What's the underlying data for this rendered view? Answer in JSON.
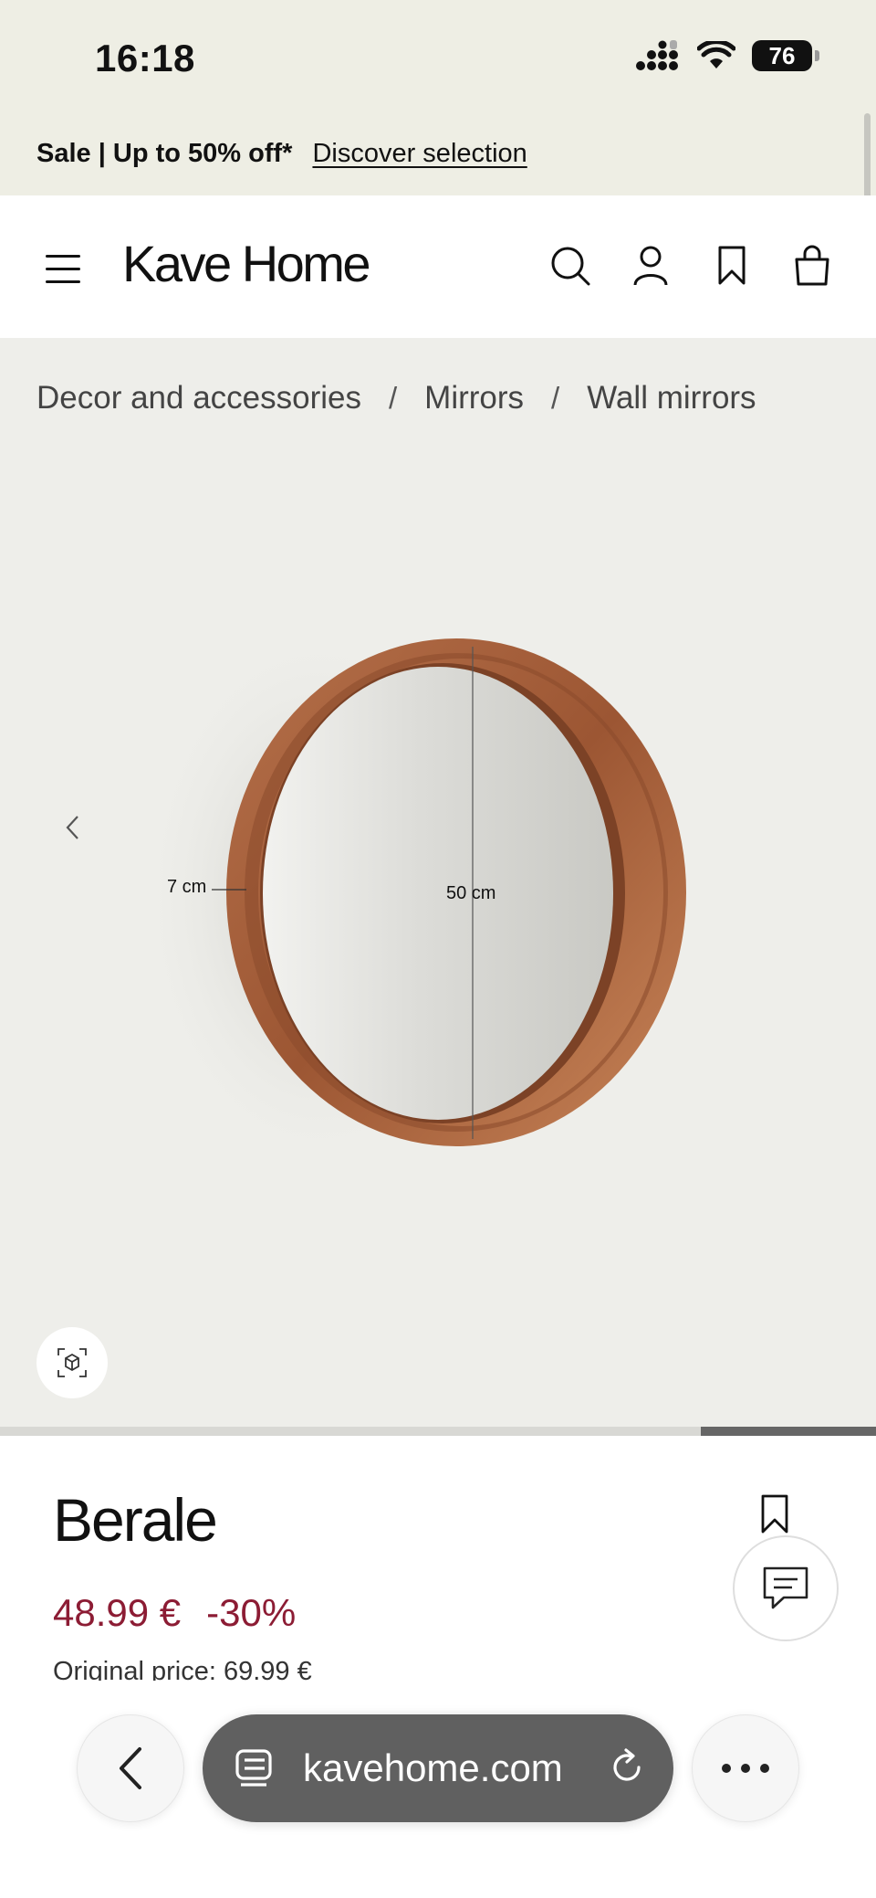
{
  "status_bar": {
    "time": "16:18",
    "battery": "76"
  },
  "promo": {
    "text": "Sale | Up to 50% off*",
    "link": "Discover selection"
  },
  "header": {
    "logo": "Kave Home"
  },
  "breadcrumb": [
    "Decor and accessories",
    "Mirrors",
    "Wall mirrors"
  ],
  "gallery": {
    "depth_label": "7 cm",
    "diameter_label": "50 cm",
    "progress": 0.2
  },
  "product": {
    "name": "Berale",
    "price": "48.99 €",
    "discount": "-30%",
    "original_price": "Original price: 69.99 €"
  },
  "browser": {
    "url": "kavehome.com"
  },
  "icons": {
    "menu": "hamburger-icon",
    "search": "search-icon",
    "account": "user-icon",
    "wishlist": "bookmark-icon",
    "cart": "shopping-bag-icon",
    "ar": "ar-view-icon",
    "chat": "chat-icon"
  },
  "colors": {
    "price": "#8c1c34",
    "banner": "#eeeee4",
    "stage": "#eeeeea"
  }
}
